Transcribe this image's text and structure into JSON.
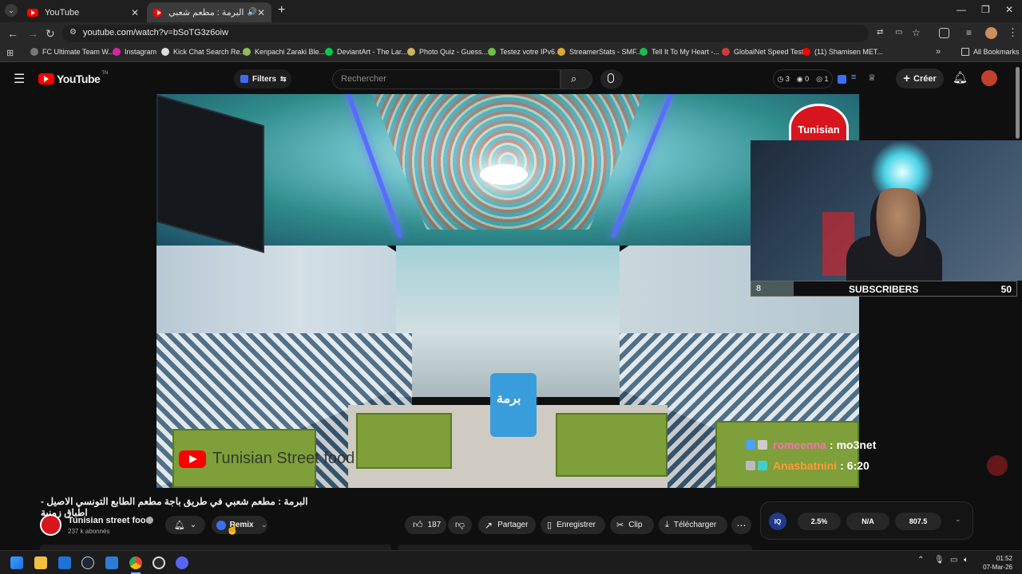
{
  "browser": {
    "tabs": [
      {
        "title": "YouTube"
      },
      {
        "title": "البرمة : مطعم شعبي في طر"
      }
    ],
    "new_tab": "+",
    "url": "youtube.com/watch?v=bSoTG3z6oiw",
    "bookmarks": [
      "FC Ultimate Team W...",
      "Instagram",
      "Kick Chat Search Re...",
      "Kenpachi Zaraki Ble...",
      "DeviantArt - The Lar...",
      "Photo Quiz - Guess...",
      "Testez votre IPv6.",
      "StreamerStats - SMF...",
      "Tell It To My Heart -...",
      "GlobalNet Speed Test",
      "(11) Shamisen MET..."
    ],
    "all_bookmarks": "All Bookmarks"
  },
  "youtube": {
    "logo": "YouTube",
    "logo_sup": "TN",
    "filters": "Filters",
    "search_placeholder": "Rechercher",
    "counters": {
      "a": "3",
      "b": "0",
      "c": "1"
    },
    "create": "Créer"
  },
  "video": {
    "watermark": "Tunisian Street food",
    "badge": "Tunisian",
    "subscribers": {
      "current": "8",
      "label": "SUBSCRIBERS",
      "goal": "50",
      "progress": 0.16
    },
    "chat": [
      {
        "user": "romeenna",
        "message": "mo3net",
        "color": "#ff6fb5"
      },
      {
        "user": "Anasbatnini",
        "message": "6:20",
        "color": "#ff9b3d"
      }
    ]
  },
  "meta": {
    "title": "البرمة : مطعم شعبي في طريق باجة مطعم الطابع التونسي الاصيل - اطباق زمنية",
    "channel": "Tunisian street food",
    "subscribers": "237 k abonnés",
    "remix": "Remix",
    "likes": "187",
    "share": "Partager",
    "save": "Enregistrer",
    "clip": "Clip",
    "download": "Télécharger"
  },
  "iq_panel": {
    "logo": "IQ",
    "v1": "2.5%",
    "v2": "N/A",
    "v3": "807.5"
  },
  "clock": {
    "time": "01:52",
    "date": "07-Mar-26"
  },
  "colors": {
    "accent_red": "#ff0000",
    "bg": "#0f0f0f"
  }
}
